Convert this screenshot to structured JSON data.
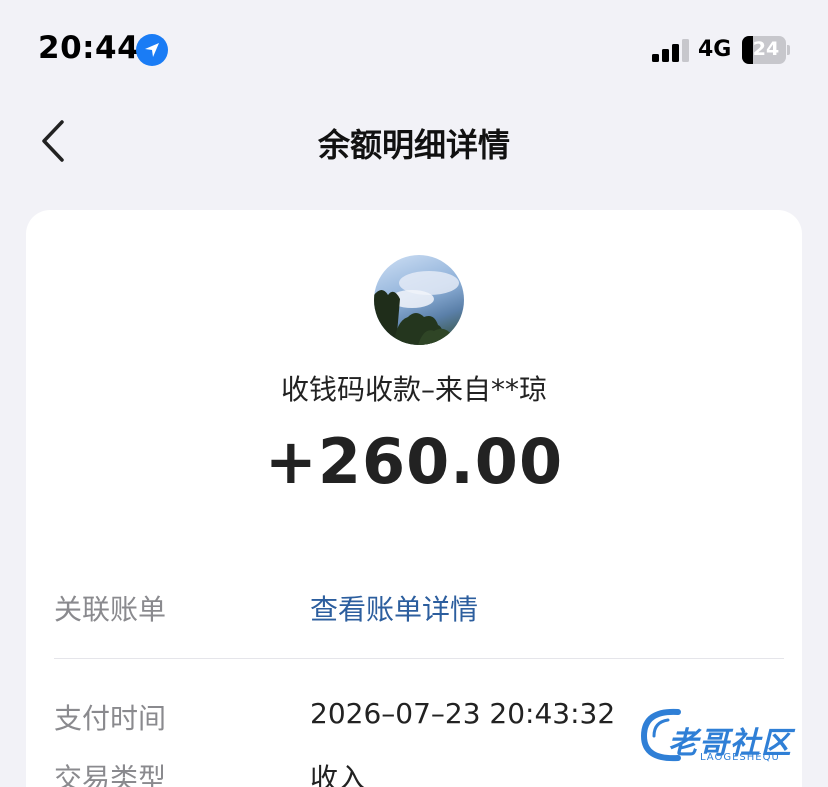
{
  "status_bar": {
    "time": "20:44",
    "network": "4G",
    "battery": "24",
    "battery_level": 0.24,
    "location_icon": "location-arrow-icon",
    "signal_icon": "cellular-signal-icon",
    "battery_icon": "battery-icon"
  },
  "nav": {
    "back_icon": "chevron-left-icon",
    "title": "余额明细详情"
  },
  "detail": {
    "merchant": "收钱码收款–来自**琼",
    "amount": "+260.00",
    "rows": [
      {
        "label": "关联账单",
        "value": "查看账单详情",
        "is_link": true
      },
      {
        "label": "支付时间",
        "value": "2026–07–23 20:43:32",
        "is_link": false
      },
      {
        "label": "交易类型",
        "value": "收入",
        "is_link": false
      }
    ]
  },
  "watermark": {
    "text": "老哥社区",
    "subtext": "LAOGESHEQU"
  },
  "colors": {
    "link": "#2c5e9e",
    "location_icon": "#1a7cf5",
    "watermark": "#2f7fd6"
  }
}
